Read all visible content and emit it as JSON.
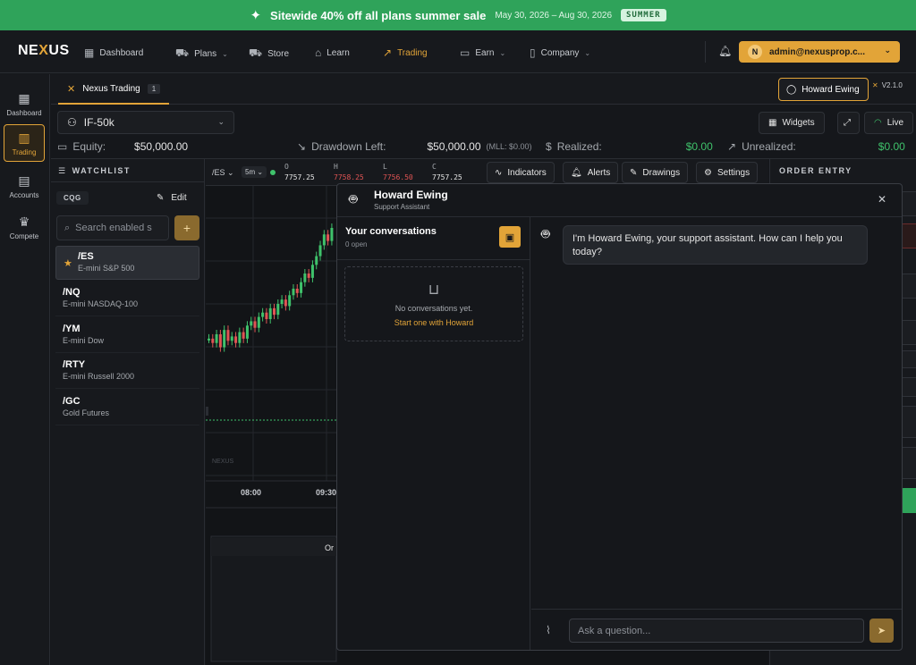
{
  "promo": {
    "title": "Sitewide 40% off all plans summer sale",
    "dates": "May 30, 2026 – Aug 30, 2026",
    "code": "SUMMER"
  },
  "nav": {
    "logo_a": "NE",
    "logo_x": "X",
    "logo_b": "US",
    "items": [
      {
        "label": "Dashboard",
        "icon": "grid-icon"
      },
      {
        "label": "Plans",
        "icon": "cart-icon"
      },
      {
        "label": "Store",
        "icon": "cart-icon"
      },
      {
        "label": "Learn",
        "icon": "graduation-cap-icon"
      },
      {
        "label": "Trading",
        "icon": "trend-up-icon"
      },
      {
        "label": "Earn",
        "icon": "wallet-icon"
      },
      {
        "label": "Company",
        "icon": "book-icon"
      }
    ],
    "user_initial": "N",
    "user_email": "admin@nexusprop.c..."
  },
  "rail": [
    {
      "label": "Dashboard",
      "icon": "grid-icon"
    },
    {
      "label": "Trading",
      "icon": "bar-chart-icon"
    },
    {
      "label": "Accounts",
      "icon": "wallet-icon"
    },
    {
      "label": "Compete",
      "icon": "trophy-icon"
    }
  ],
  "tab": {
    "label": "Nexus Trading",
    "count": "1"
  },
  "support_button": "Howard Ewing",
  "version": "V2.1.0",
  "account": {
    "name": "IF-50k"
  },
  "toolbar": {
    "widgets": "Widgets",
    "live": "Live"
  },
  "stats": {
    "equity_label": "Equity:",
    "equity_value": "$50,000.00",
    "drawdown_label": "Drawdown Left:",
    "drawdown_value": "$50,000.00",
    "mll": "(MLL: $0.00)",
    "realized_label": "Realized:",
    "realized_value": "$0.00",
    "unrealized_label": "Unrealized:",
    "unrealized_value": "$0.00"
  },
  "watchlist": {
    "title": "WATCHLIST",
    "feed": "CQG",
    "edit": "Edit",
    "search_placeholder": "Search enabled s",
    "items": [
      {
        "symbol": "/ES",
        "name": "E-mini S&P 500"
      },
      {
        "symbol": "/NQ",
        "name": "E-mini NASDAQ-100"
      },
      {
        "symbol": "/YM",
        "name": "E-mini Dow"
      },
      {
        "symbol": "/RTY",
        "name": "E-mini Russell 2000"
      },
      {
        "symbol": "/GC",
        "name": "Gold Futures"
      }
    ]
  },
  "chart": {
    "symbol": "/ES",
    "interval": "5m",
    "o_label": "O",
    "o": "7757.25",
    "h_label": "H",
    "h": "7758.25",
    "l_label": "L",
    "l": "7756.50",
    "c_label": "C",
    "c": "7757.25",
    "indicators": "Indicators",
    "alerts": "Alerts",
    "drawings": "Drawings",
    "settings": "Settings",
    "times": [
      "08:00",
      "09:30"
    ],
    "watermark": "NEXUS",
    "orders_tab": "Or"
  },
  "chart_data": {
    "type": "candlestick",
    "x": [
      "08:00",
      "09:30"
    ],
    "candles_relative": [
      52,
      50,
      54,
      48,
      56,
      51,
      53,
      50,
      55,
      52,
      58,
      60,
      57,
      62,
      64,
      61,
      66,
      63,
      68,
      70,
      67,
      72,
      75,
      73,
      78,
      82,
      80,
      86,
      90,
      95,
      100,
      97,
      103
    ]
  },
  "order_entry": {
    "title": "ORDER ENTRY"
  },
  "chat": {
    "name": "Howard Ewing",
    "role": "Support Assistant",
    "conversations_title": "Your conversations",
    "open_count": "0 open",
    "empty_text": "No conversations yet.",
    "start_link": "Start one with Howard",
    "greeting": "I'm Howard Ewing, your support assistant. How can I help you today?",
    "input_placeholder": "Ask a question..."
  },
  "colors": {
    "accent": "#e2a438",
    "positive": "#3fc26b",
    "negative": "#e05454",
    "promo": "#2fa35a"
  }
}
